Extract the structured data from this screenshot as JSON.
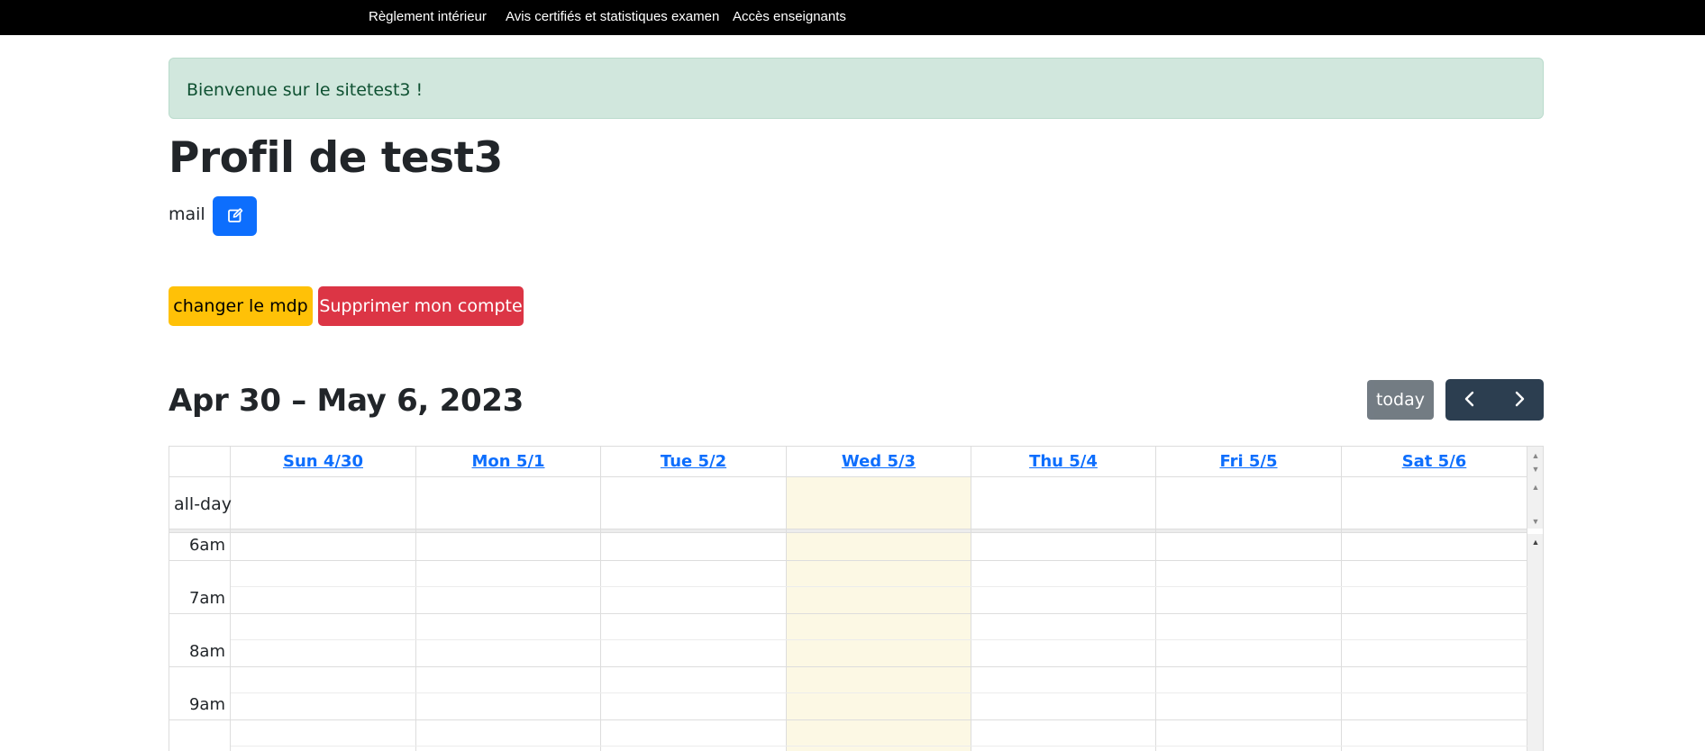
{
  "nav": {
    "links": [
      "Règlement intérieur",
      "Avis certifiés et statistiques examen",
      "Accès enseignants"
    ]
  },
  "alert": {
    "text": "Bienvenue sur le sitetest3 !"
  },
  "profile": {
    "title": "Profil de test3",
    "mail_label": "mail :",
    "edit_icon": "edit-icon",
    "change_password_label": "changer le mdp",
    "delete_account_label": "Supprimer mon compte"
  },
  "calendar": {
    "title": "Apr 30 – May 6, 2023",
    "today_label": "today",
    "prev_icon": "chevron-left-icon",
    "next_icon": "chevron-right-icon",
    "days": [
      "Sun 4/30",
      "Mon 5/1",
      "Tue 5/2",
      "Wed 5/3",
      "Thu 5/4",
      "Fri 5/5",
      "Sat 5/6"
    ],
    "highlighted_day": "Wed 5/3",
    "allday_label": "all-day",
    "times": [
      "6am",
      "7am",
      "8am",
      "9am"
    ]
  },
  "colors": {
    "primary": "#0d6efd",
    "warning": "#ffc107",
    "danger": "#dc3545",
    "today_bg": "#fcf8e3",
    "alert_bg": "#d1e7dd",
    "nav_group": "#2c3e50"
  }
}
